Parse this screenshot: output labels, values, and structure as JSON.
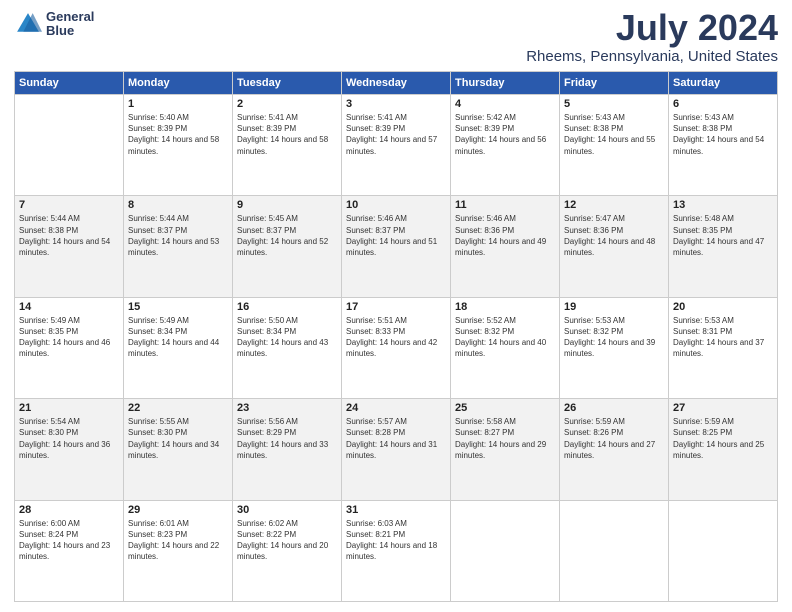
{
  "header": {
    "logo_line1": "General",
    "logo_line2": "Blue",
    "month": "July 2024",
    "location": "Rheems, Pennsylvania, United States"
  },
  "weekdays": [
    "Sunday",
    "Monday",
    "Tuesday",
    "Wednesday",
    "Thursday",
    "Friday",
    "Saturday"
  ],
  "weeks": [
    [
      {
        "day": "",
        "sunrise": "",
        "sunset": "",
        "daylight": ""
      },
      {
        "day": "1",
        "sunrise": "Sunrise: 5:40 AM",
        "sunset": "Sunset: 8:39 PM",
        "daylight": "Daylight: 14 hours and 58 minutes."
      },
      {
        "day": "2",
        "sunrise": "Sunrise: 5:41 AM",
        "sunset": "Sunset: 8:39 PM",
        "daylight": "Daylight: 14 hours and 58 minutes."
      },
      {
        "day": "3",
        "sunrise": "Sunrise: 5:41 AM",
        "sunset": "Sunset: 8:39 PM",
        "daylight": "Daylight: 14 hours and 57 minutes."
      },
      {
        "day": "4",
        "sunrise": "Sunrise: 5:42 AM",
        "sunset": "Sunset: 8:39 PM",
        "daylight": "Daylight: 14 hours and 56 minutes."
      },
      {
        "day": "5",
        "sunrise": "Sunrise: 5:43 AM",
        "sunset": "Sunset: 8:38 PM",
        "daylight": "Daylight: 14 hours and 55 minutes."
      },
      {
        "day": "6",
        "sunrise": "Sunrise: 5:43 AM",
        "sunset": "Sunset: 8:38 PM",
        "daylight": "Daylight: 14 hours and 54 minutes."
      }
    ],
    [
      {
        "day": "7",
        "sunrise": "Sunrise: 5:44 AM",
        "sunset": "Sunset: 8:38 PM",
        "daylight": "Daylight: 14 hours and 54 minutes."
      },
      {
        "day": "8",
        "sunrise": "Sunrise: 5:44 AM",
        "sunset": "Sunset: 8:37 PM",
        "daylight": "Daylight: 14 hours and 53 minutes."
      },
      {
        "day": "9",
        "sunrise": "Sunrise: 5:45 AM",
        "sunset": "Sunset: 8:37 PM",
        "daylight": "Daylight: 14 hours and 52 minutes."
      },
      {
        "day": "10",
        "sunrise": "Sunrise: 5:46 AM",
        "sunset": "Sunset: 8:37 PM",
        "daylight": "Daylight: 14 hours and 51 minutes."
      },
      {
        "day": "11",
        "sunrise": "Sunrise: 5:46 AM",
        "sunset": "Sunset: 8:36 PM",
        "daylight": "Daylight: 14 hours and 49 minutes."
      },
      {
        "day": "12",
        "sunrise": "Sunrise: 5:47 AM",
        "sunset": "Sunset: 8:36 PM",
        "daylight": "Daylight: 14 hours and 48 minutes."
      },
      {
        "day": "13",
        "sunrise": "Sunrise: 5:48 AM",
        "sunset": "Sunset: 8:35 PM",
        "daylight": "Daylight: 14 hours and 47 minutes."
      }
    ],
    [
      {
        "day": "14",
        "sunrise": "Sunrise: 5:49 AM",
        "sunset": "Sunset: 8:35 PM",
        "daylight": "Daylight: 14 hours and 46 minutes."
      },
      {
        "day": "15",
        "sunrise": "Sunrise: 5:49 AM",
        "sunset": "Sunset: 8:34 PM",
        "daylight": "Daylight: 14 hours and 44 minutes."
      },
      {
        "day": "16",
        "sunrise": "Sunrise: 5:50 AM",
        "sunset": "Sunset: 8:34 PM",
        "daylight": "Daylight: 14 hours and 43 minutes."
      },
      {
        "day": "17",
        "sunrise": "Sunrise: 5:51 AM",
        "sunset": "Sunset: 8:33 PM",
        "daylight": "Daylight: 14 hours and 42 minutes."
      },
      {
        "day": "18",
        "sunrise": "Sunrise: 5:52 AM",
        "sunset": "Sunset: 8:32 PM",
        "daylight": "Daylight: 14 hours and 40 minutes."
      },
      {
        "day": "19",
        "sunrise": "Sunrise: 5:53 AM",
        "sunset": "Sunset: 8:32 PM",
        "daylight": "Daylight: 14 hours and 39 minutes."
      },
      {
        "day": "20",
        "sunrise": "Sunrise: 5:53 AM",
        "sunset": "Sunset: 8:31 PM",
        "daylight": "Daylight: 14 hours and 37 minutes."
      }
    ],
    [
      {
        "day": "21",
        "sunrise": "Sunrise: 5:54 AM",
        "sunset": "Sunset: 8:30 PM",
        "daylight": "Daylight: 14 hours and 36 minutes."
      },
      {
        "day": "22",
        "sunrise": "Sunrise: 5:55 AM",
        "sunset": "Sunset: 8:30 PM",
        "daylight": "Daylight: 14 hours and 34 minutes."
      },
      {
        "day": "23",
        "sunrise": "Sunrise: 5:56 AM",
        "sunset": "Sunset: 8:29 PM",
        "daylight": "Daylight: 14 hours and 33 minutes."
      },
      {
        "day": "24",
        "sunrise": "Sunrise: 5:57 AM",
        "sunset": "Sunset: 8:28 PM",
        "daylight": "Daylight: 14 hours and 31 minutes."
      },
      {
        "day": "25",
        "sunrise": "Sunrise: 5:58 AM",
        "sunset": "Sunset: 8:27 PM",
        "daylight": "Daylight: 14 hours and 29 minutes."
      },
      {
        "day": "26",
        "sunrise": "Sunrise: 5:59 AM",
        "sunset": "Sunset: 8:26 PM",
        "daylight": "Daylight: 14 hours and 27 minutes."
      },
      {
        "day": "27",
        "sunrise": "Sunrise: 5:59 AM",
        "sunset": "Sunset: 8:25 PM",
        "daylight": "Daylight: 14 hours and 25 minutes."
      }
    ],
    [
      {
        "day": "28",
        "sunrise": "Sunrise: 6:00 AM",
        "sunset": "Sunset: 8:24 PM",
        "daylight": "Daylight: 14 hours and 23 minutes."
      },
      {
        "day": "29",
        "sunrise": "Sunrise: 6:01 AM",
        "sunset": "Sunset: 8:23 PM",
        "daylight": "Daylight: 14 hours and 22 minutes."
      },
      {
        "day": "30",
        "sunrise": "Sunrise: 6:02 AM",
        "sunset": "Sunset: 8:22 PM",
        "daylight": "Daylight: 14 hours and 20 minutes."
      },
      {
        "day": "31",
        "sunrise": "Sunrise: 6:03 AM",
        "sunset": "Sunset: 8:21 PM",
        "daylight": "Daylight: 14 hours and 18 minutes."
      },
      {
        "day": "",
        "sunrise": "",
        "sunset": "",
        "daylight": ""
      },
      {
        "day": "",
        "sunrise": "",
        "sunset": "",
        "daylight": ""
      },
      {
        "day": "",
        "sunrise": "",
        "sunset": "",
        "daylight": ""
      }
    ]
  ]
}
